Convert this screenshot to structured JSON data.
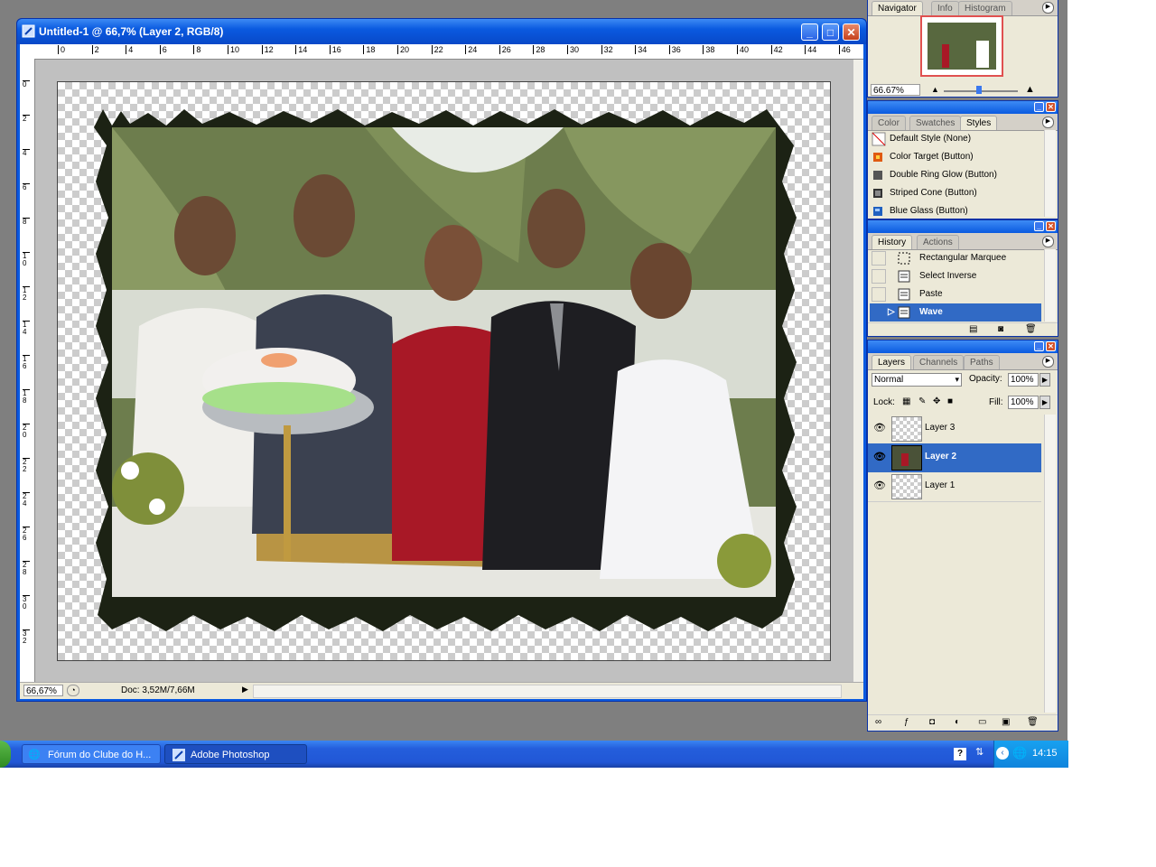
{
  "document": {
    "title": "Untitled-1 @ 66,7% (Layer 2, RGB/8)",
    "ruler_top_labels": [
      "0",
      "2",
      "4",
      "6",
      "8",
      "10",
      "12",
      "14",
      "16",
      "18",
      "20",
      "22",
      "24",
      "26",
      "28",
      "30",
      "32",
      "34",
      "36",
      "38",
      "40",
      "42",
      "44",
      "46"
    ],
    "ruler_left_labels": [
      "0",
      "2",
      "4",
      "6",
      "8",
      "10",
      "12",
      "14",
      "16",
      "18",
      "20",
      "22",
      "24",
      "26",
      "28",
      "30",
      "32"
    ],
    "zoom": "66,67%",
    "doc_size": "Doc: 3,52M/7,66M"
  },
  "navigator": {
    "tabs": [
      "Navigator",
      "Info",
      "Histogram"
    ],
    "zoom": "66.67%"
  },
  "styles_panel": {
    "tabs": [
      "Color",
      "Swatches",
      "Styles"
    ],
    "items": [
      {
        "label": "Default Style (None)",
        "icon": "none-style-icon"
      },
      {
        "label": "Color Target (Button)",
        "icon": "color-target-icon"
      },
      {
        "label": "Double Ring Glow (Button)",
        "icon": "double-ring-icon"
      },
      {
        "label": "Striped Cone (Button)",
        "icon": "striped-cone-icon"
      },
      {
        "label": "Blue Glass (Button)",
        "icon": "blue-glass-icon"
      }
    ]
  },
  "history_panel": {
    "tabs": [
      "History",
      "Actions"
    ],
    "items": [
      {
        "label": "Rectangular Marquee",
        "selected": false
      },
      {
        "label": "Select Inverse",
        "selected": false
      },
      {
        "label": "Paste",
        "selected": false
      },
      {
        "label": "Wave",
        "selected": true
      }
    ]
  },
  "layers_panel": {
    "tabs": [
      "Layers",
      "Channels",
      "Paths"
    ],
    "blend_mode": "Normal",
    "opacity_label": "Opacity:",
    "opacity": "100%",
    "lock_label": "Lock:",
    "fill_label": "Fill:",
    "fill": "100%",
    "layers": [
      {
        "name": "Layer 3",
        "selected": false
      },
      {
        "name": "Layer 2",
        "selected": true
      },
      {
        "name": "Layer 1",
        "selected": false
      }
    ]
  },
  "taskbar": {
    "tasks": [
      {
        "label": "Fórum do Clube do H...",
        "active": false
      },
      {
        "label": "Adobe Photoshop",
        "active": true
      }
    ],
    "clock": "14:15"
  },
  "colors": {
    "xp_blue": "#0a5ae0",
    "panel_bg": "#ece9d8",
    "selection": "#316ac5"
  }
}
